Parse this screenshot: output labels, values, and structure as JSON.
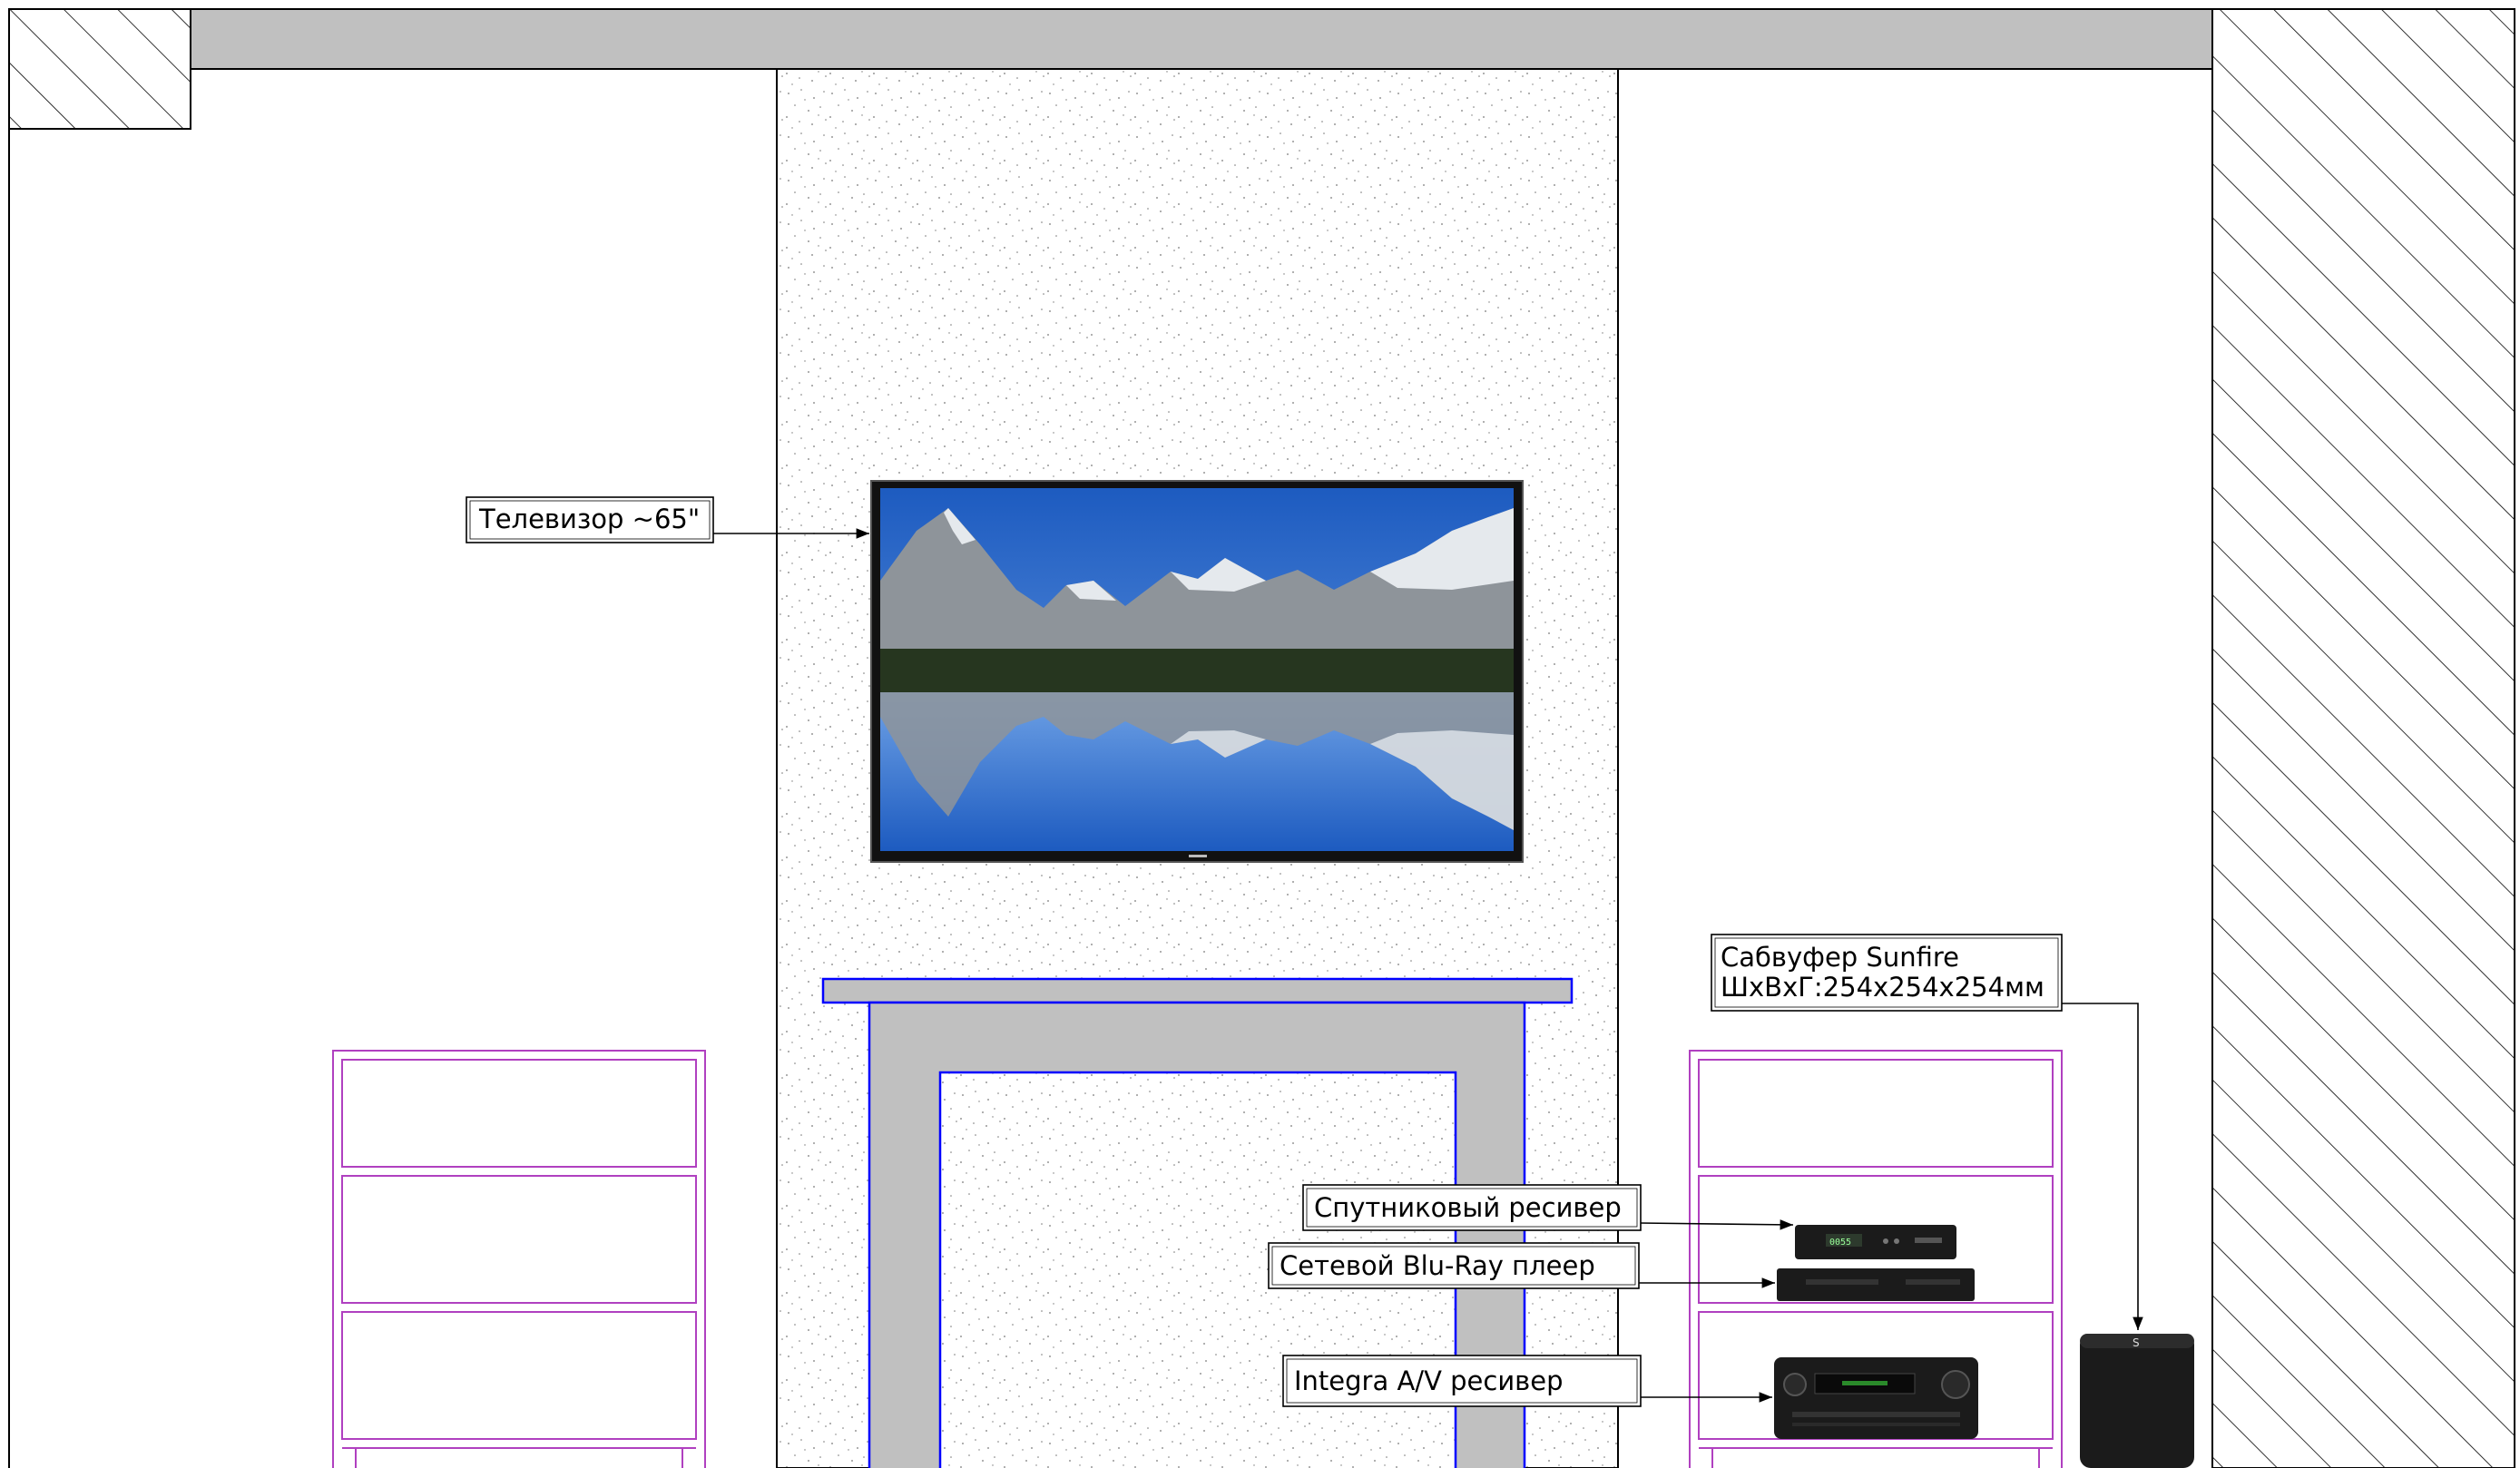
{
  "labels": {
    "tv": "Телевизор ~65\"",
    "subwoofer_line1": "Сабвуфер Sunfire",
    "subwoofer_line2": "ШхВхГ:254х254х254мм",
    "satellite": "Спутниковый ресивер",
    "bluray": "Сетевой Blu-Ray плеер",
    "av_receiver": "Integra A/V ресивер"
  },
  "colors": {
    "line": "#000000",
    "concrete": "#c0c0c0",
    "fireplace_outline": "#0000ff",
    "shelving": "#b040c0",
    "sky": "#2f6fd0",
    "snow": "#eef2f6",
    "rock": "#8e949a",
    "forest": "#26361f",
    "device": "#1b1b1b"
  }
}
